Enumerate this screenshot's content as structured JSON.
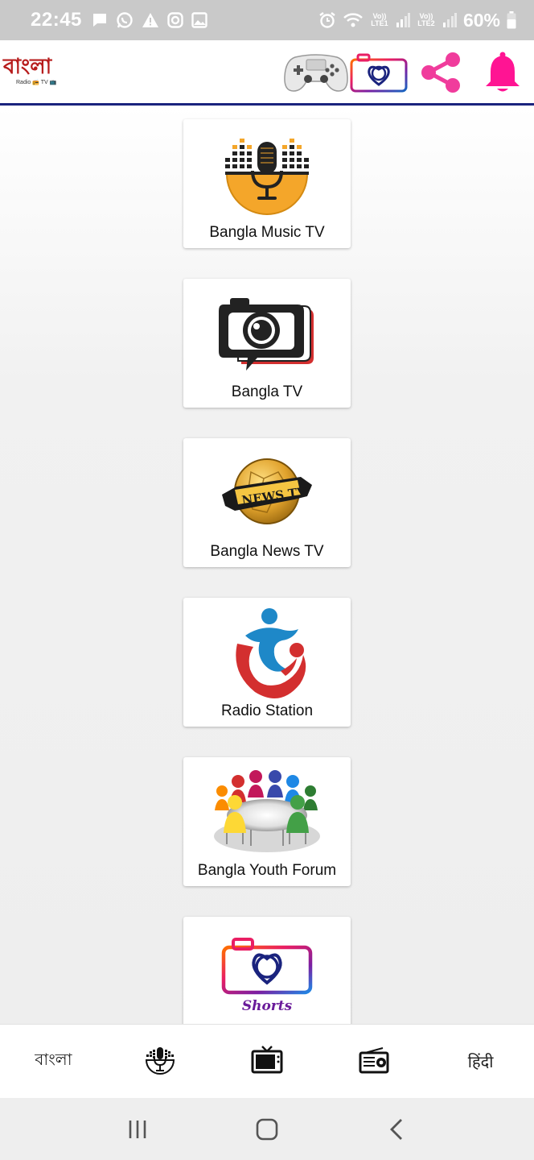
{
  "status_bar": {
    "time": "22:45",
    "battery": "60%",
    "sim1_label": "Vo)) LTE1",
    "sim2_label": "Vo)) LTE2"
  },
  "app_bar": {
    "logo_text": "বাংলা",
    "logo_subtext": "Radio 📻 TV 📺",
    "icons": [
      "gamepad-icon",
      "shorts-camera-icon",
      "share-icon",
      "bell-icon"
    ],
    "colors": {
      "share": "#f03c9c",
      "bell": "#ff1493",
      "underline": "#1a237e"
    }
  },
  "cards": [
    {
      "label": "Bangla Music TV",
      "icon": "music-mic-icon"
    },
    {
      "label": "Bangla TV",
      "icon": "tv-camera-icon"
    },
    {
      "label": "Bangla News TV",
      "icon": "news-globe-icon"
    },
    {
      "label": "Radio Station",
      "icon": "radio-station-icon"
    },
    {
      "label": "Bangla Youth Forum",
      "icon": "youth-forum-icon"
    },
    {
      "label": "",
      "icon": "shorts-logo-icon",
      "logo_text": "Shorts"
    }
  ],
  "bottom_nav": {
    "items": [
      {
        "label": "বাংলা",
        "icon": ""
      },
      {
        "label": "",
        "icon": "music-mic-icon"
      },
      {
        "label": "",
        "icon": "tv-icon"
      },
      {
        "label": "",
        "icon": "radio-icon"
      },
      {
        "label": "हिंदी",
        "icon": ""
      }
    ]
  },
  "system_nav": {
    "icons": [
      "recent-apps-icon",
      "home-icon",
      "back-icon"
    ]
  }
}
